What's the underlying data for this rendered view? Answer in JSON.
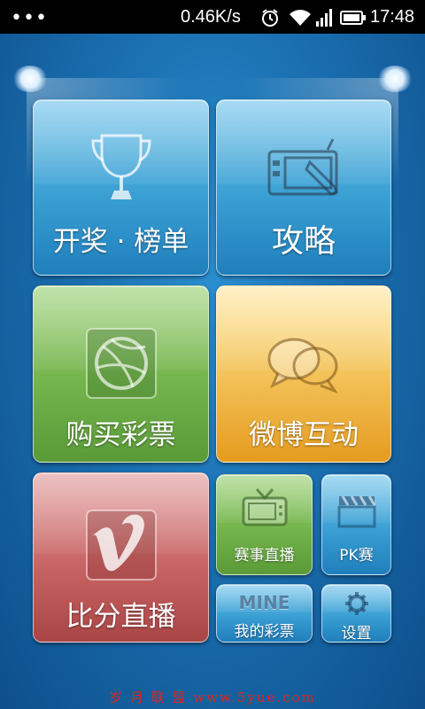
{
  "status_bar": {
    "dots": "•••",
    "net_speed": "0.46K/s",
    "time": "17:48",
    "icons": [
      "alarm-icon",
      "wifi-icon",
      "signal-icon",
      "battery-icon"
    ]
  },
  "tiles": {
    "draw_rank": {
      "label": "开奖 · 榜单",
      "icon": "trophy-icon"
    },
    "guide": {
      "label": "攻略",
      "icon": "tablet-pen-icon"
    },
    "buy_lottery": {
      "label": "购买彩票",
      "icon": "dribbble-ball-icon"
    },
    "weibo": {
      "label": "微博互动",
      "icon": "speech-bubbles-icon"
    },
    "live_score": {
      "label": "比分直播",
      "icon": "vimeo-v-icon"
    },
    "match_live": {
      "label": "赛事直播",
      "icon": "tv-icon"
    },
    "pk": {
      "label": "PK赛",
      "icon": "clapperboard-icon"
    },
    "my_lottery": {
      "label": "我的彩票",
      "icon_text": "MINE"
    },
    "settings": {
      "label": "设置",
      "icon": "gear-icon"
    }
  },
  "colors": {
    "blue_tile": "#3a9fd3",
    "green_tile": "#73b44c",
    "orange_tile": "#f3c35a",
    "red_tile": "#c96464",
    "background": "#1a6fb0",
    "footer_text": "#e0231b"
  },
  "footer": {
    "text": "岁 月 联 盟   www.5yue.com"
  }
}
